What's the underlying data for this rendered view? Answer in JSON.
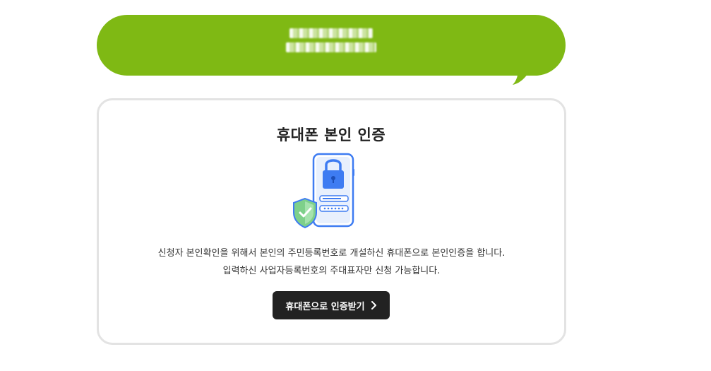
{
  "bubble": {
    "color": "#7fb914",
    "text_redacted": true
  },
  "verification": {
    "title": "휴대폰 본인 인증",
    "illustration_icon": "phone-lock-shield-icon",
    "description_line1": "신청자 본인확인을 위해서 본인의 주민등록번호로 개설하신 휴대폰으로 본인인증을 합니다.",
    "description_line2": "입력하신 사업자등록번호의 주대표자만 신청 가능합니다.",
    "button_label": "휴대폰으로 인증받기",
    "button_icon": "chevron-right-icon"
  },
  "colors": {
    "button_bg": "#222222",
    "card_border": "#e3e3e3",
    "accent_blue": "#3e7cf2",
    "shield_green": "#7ed08a"
  }
}
